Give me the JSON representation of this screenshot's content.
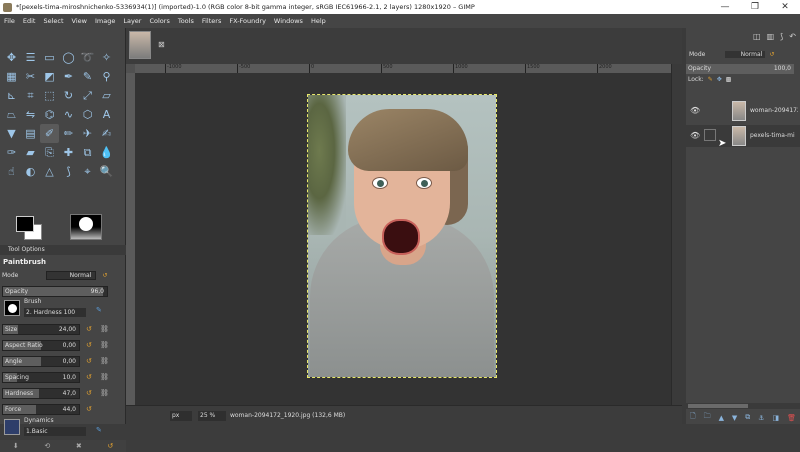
{
  "window": {
    "title": "*[pexels-tima-miroshnichenko-5336934(1)] (imported)-1.0 (RGB color 8-bit gamma integer, sRGB IEC61966-2.1, 2 layers) 1280x1920 – GIMP",
    "minimize": "—",
    "maximize": "❐",
    "close": "✕"
  },
  "menu": [
    "File",
    "Edit",
    "Select",
    "View",
    "Image",
    "Layer",
    "Colors",
    "Tools",
    "Filters",
    "FX-Foundry",
    "Windows",
    "Help"
  ],
  "tools": [
    {
      "name": "move-tool-icon",
      "glyph": "✥"
    },
    {
      "name": "align-tool-icon",
      "glyph": "☰"
    },
    {
      "name": "rect-select-tool-icon",
      "glyph": "▭"
    },
    {
      "name": "ellipse-select-tool-icon",
      "glyph": "◯"
    },
    {
      "name": "free-select-tool-icon",
      "glyph": "➰"
    },
    {
      "name": "fuzzy-select-tool-icon",
      "glyph": "✧"
    },
    {
      "name": "color-select-tool-icon",
      "glyph": "▦"
    },
    {
      "name": "scissors-tool-icon",
      "glyph": "✂"
    },
    {
      "name": "foreground-select-tool-icon",
      "glyph": "◩"
    },
    {
      "name": "paths-tool-icon",
      "glyph": "✒"
    },
    {
      "name": "color-picker-tool-icon",
      "glyph": "✎"
    },
    {
      "name": "zoom-tool-icon",
      "glyph": "⚲"
    },
    {
      "name": "measure-tool-icon",
      "glyph": "⊾"
    },
    {
      "name": "crop-tool-icon",
      "glyph": "⌗"
    },
    {
      "name": "unified-transform-tool-icon",
      "glyph": "⬚"
    },
    {
      "name": "rotate-tool-icon",
      "glyph": "↻"
    },
    {
      "name": "scale-tool-icon",
      "glyph": "⤢"
    },
    {
      "name": "shear-tool-icon",
      "glyph": "▱"
    },
    {
      "name": "perspective-tool-icon",
      "glyph": "⏢"
    },
    {
      "name": "flip-tool-icon",
      "glyph": "⇋"
    },
    {
      "name": "cage-tool-icon",
      "glyph": "⌬"
    },
    {
      "name": "warp-tool-icon",
      "glyph": "∿"
    },
    {
      "name": "handle-transform-tool-icon",
      "glyph": "⬡"
    },
    {
      "name": "text-tool-icon",
      "glyph": "A"
    },
    {
      "name": "bucket-fill-tool-icon",
      "glyph": "▼"
    },
    {
      "name": "gradient-tool-icon",
      "glyph": "▤"
    },
    {
      "name": "paintbrush-tool-icon",
      "glyph": "✐"
    },
    {
      "name": "pencil-tool-icon",
      "glyph": "✏"
    },
    {
      "name": "airbrush-tool-icon",
      "glyph": "✈"
    },
    {
      "name": "ink-tool-icon",
      "glyph": "✍"
    },
    {
      "name": "mypaint-brush-tool-icon",
      "glyph": "✑"
    },
    {
      "name": "eraser-tool-icon",
      "glyph": "▰"
    },
    {
      "name": "clone-tool-icon",
      "glyph": "⎘"
    },
    {
      "name": "heal-tool-icon",
      "glyph": "✚"
    },
    {
      "name": "perspective-clone-tool-icon",
      "glyph": "⧉"
    },
    {
      "name": "blur-tool-icon",
      "glyph": "💧"
    },
    {
      "name": "smudge-tool-icon",
      "glyph": "☝"
    },
    {
      "name": "dodge-burn-tool-icon",
      "glyph": "◐"
    },
    {
      "name": "sharpen-tool-icon",
      "glyph": "△"
    },
    {
      "name": "paths-edit-tool-icon",
      "glyph": "⟆"
    },
    {
      "name": "scissors-select-tool-icon",
      "glyph": "⌖"
    },
    {
      "name": "zoom-view-tool-icon",
      "glyph": "🔍"
    }
  ],
  "tool_options": {
    "tab_label": "Tool Options",
    "title": "Paintbrush",
    "mode_label": "Mode",
    "mode_value": "Normal",
    "opacity_label": "Opacity",
    "opacity_value": "96,0",
    "brush_label": "Brush",
    "brush_name": "2. Hardness 100",
    "size_label": "Size",
    "size_value": "24,00",
    "aspect_label": "Aspect Ratio",
    "aspect_value": "0,00",
    "angle_label": "Angle",
    "angle_value": "0,00",
    "spacing_label": "Spacing",
    "spacing_value": "10,0",
    "hardness_label": "Hardness",
    "hardness_value": "47,0",
    "force_label": "Force",
    "force_value": "44,0",
    "dynamics_label": "Dynamics",
    "dynamics_name": "1.Basic"
  },
  "ruler": {
    "labels": [
      "-1000",
      "-500",
      "0",
      "500",
      "1000",
      "1500",
      "2000"
    ]
  },
  "statusbar": {
    "unit": "px",
    "zoom": "25 %",
    "file_info": "woman-2094172_1920.jpg (132,6 MB)"
  },
  "layers_panel": {
    "mode_label": "Mode",
    "mode_value": "Normal",
    "opacity_label": "Opacity",
    "opacity_value": "100,0",
    "lock_label": "Lock:",
    "layers": [
      {
        "name": "woman-2094172_"
      },
      {
        "name": "pexels-tima-mi"
      }
    ]
  },
  "colors": {
    "foreground": "#000000",
    "background": "#ffffff",
    "selection_border": "#e8e86a"
  }
}
